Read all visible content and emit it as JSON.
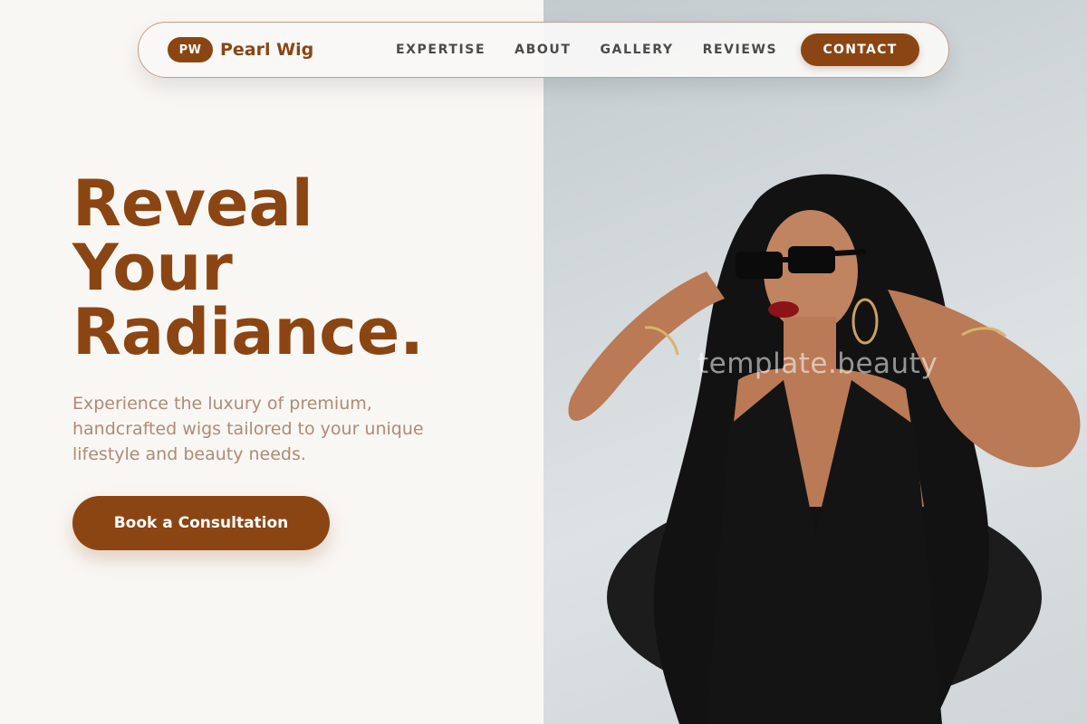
{
  "brand": {
    "initials": "PW",
    "name": "Pearl Wig"
  },
  "nav": {
    "links": [
      "EXPERTISE",
      "ABOUT",
      "GALLERY",
      "REVIEWS"
    ],
    "contact_label": "CONTACT"
  },
  "hero": {
    "title_lines": [
      "Reveal",
      "Your",
      "Radiance."
    ],
    "subtitle": "Experience the luxury of premium, handcrafted wigs tailored to your unique lifestyle and beauty needs.",
    "cta_label": "Book a Consultation"
  },
  "photo": {
    "watermark": "template.beauty"
  },
  "colors": {
    "accent": "#8b4513",
    "background": "#f9f7f4",
    "subtitle": "#b08a74"
  }
}
